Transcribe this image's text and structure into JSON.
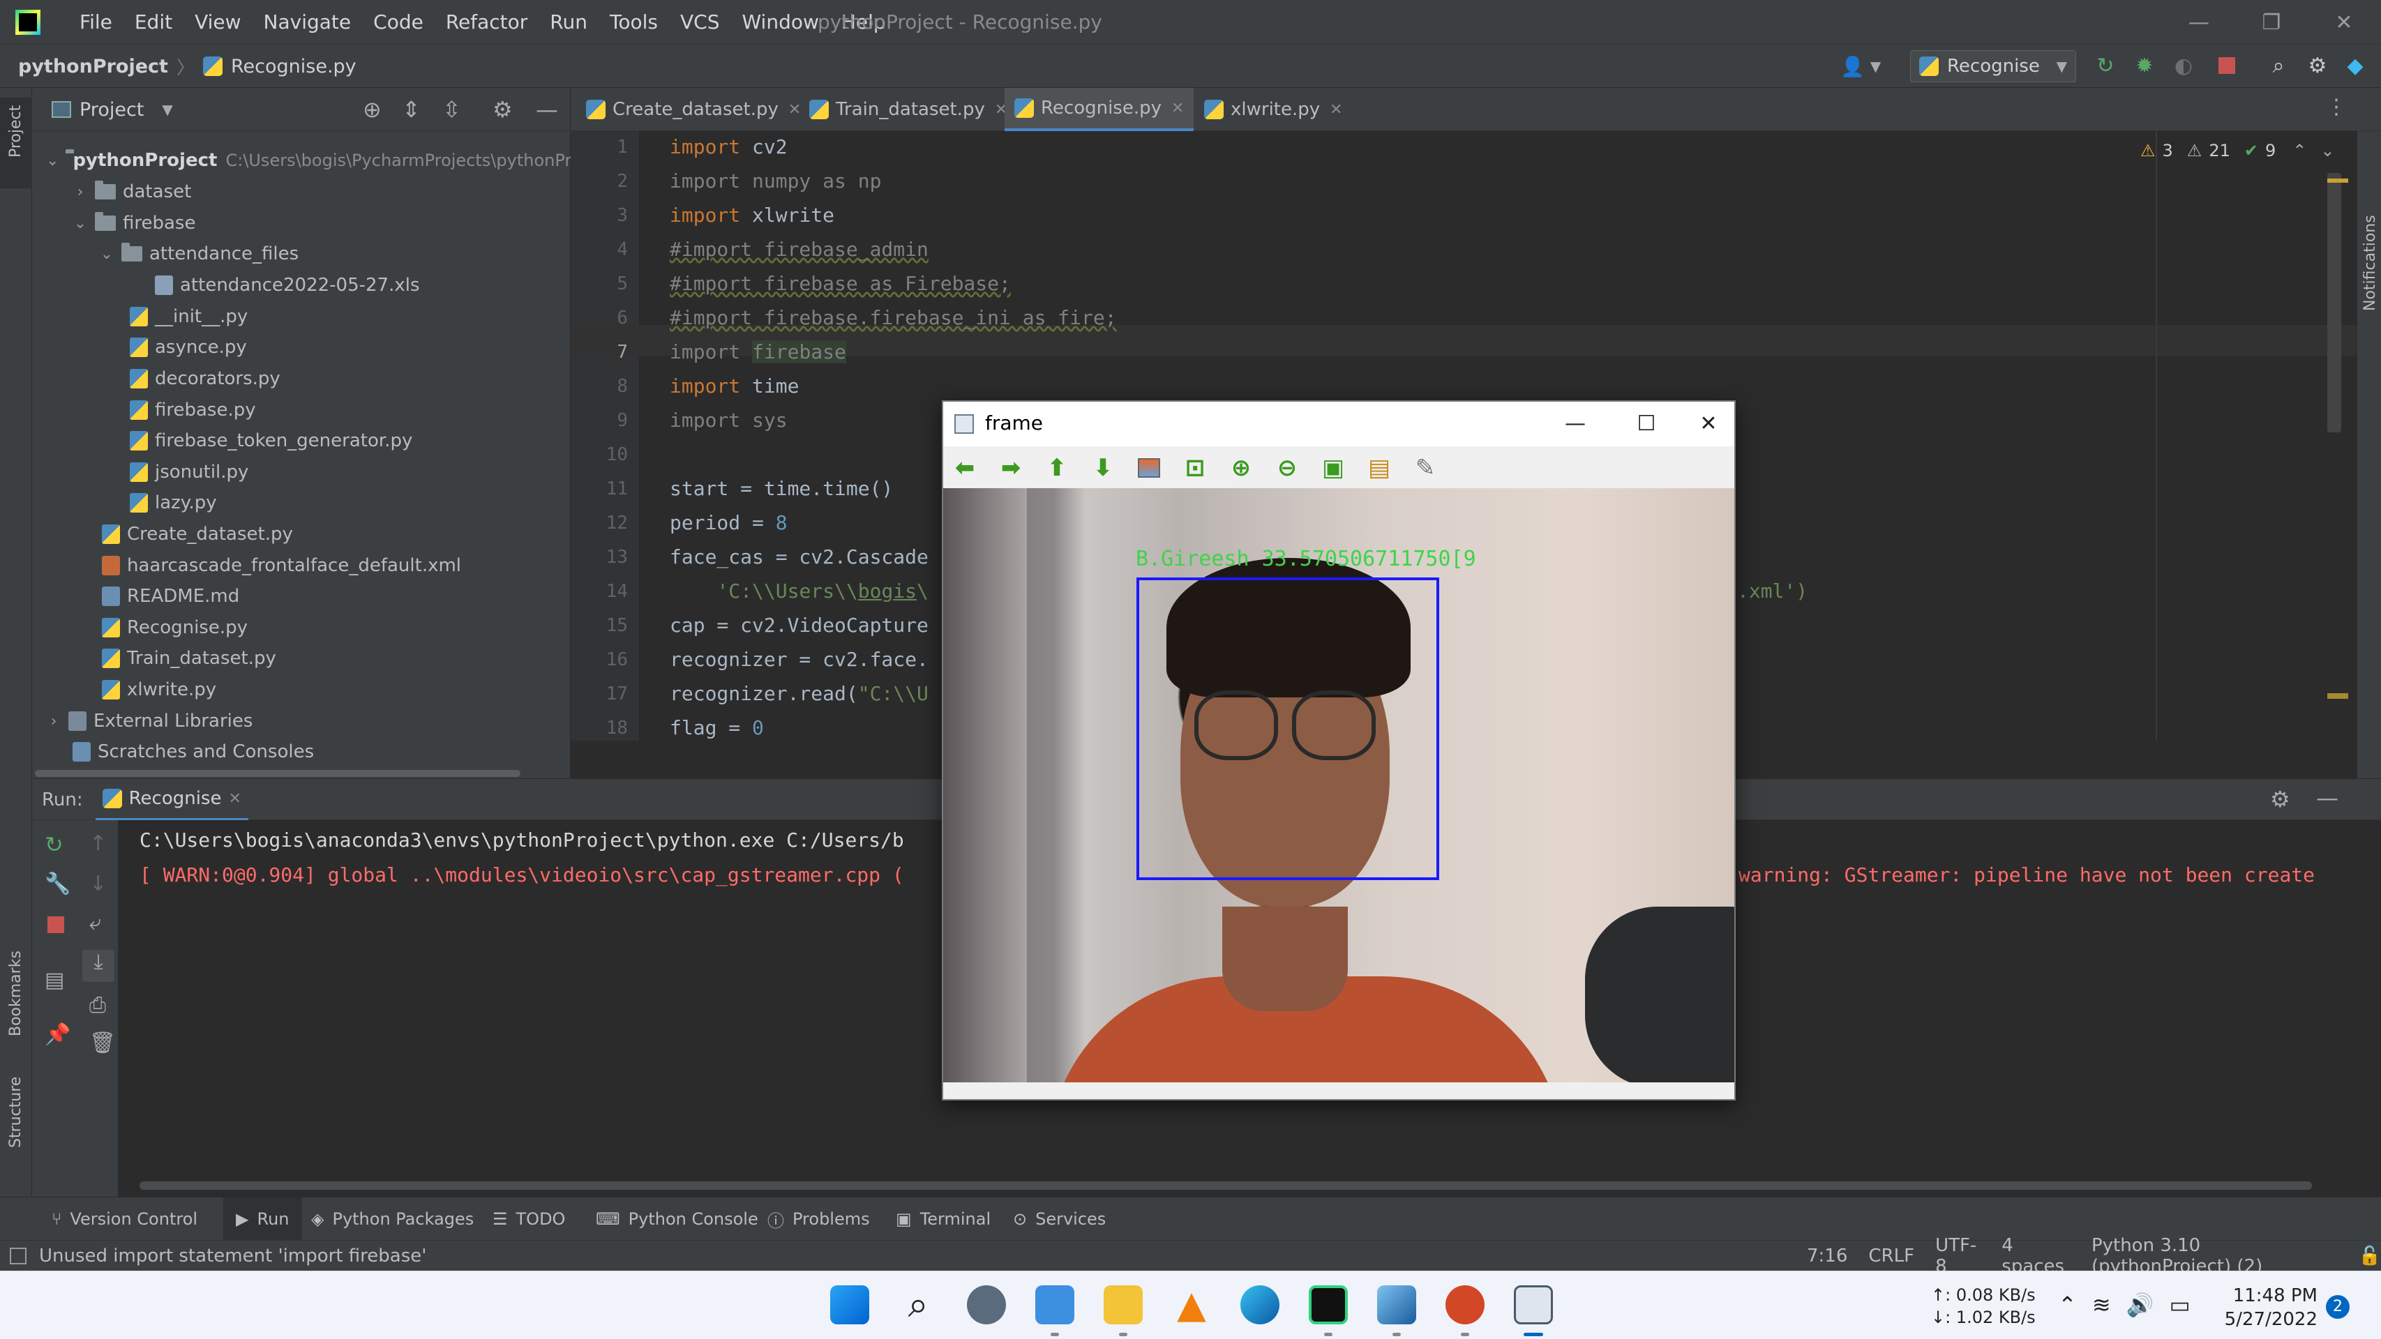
{
  "titlebar": {
    "menu": [
      "File",
      "Edit",
      "View",
      "Navigate",
      "Code",
      "Refactor",
      "Run",
      "Tools",
      "VCS",
      "Window",
      "Help"
    ],
    "window_title": "pythonProject - Recognise.py"
  },
  "navbar": {
    "project": "pythonProject",
    "file": "Recognise.py",
    "run_config": "Recognise"
  },
  "project_panel": {
    "title": "Project",
    "root_name": "pythonProject",
    "root_path": "C:\\Users\\bogis\\PycharmProjects\\pythonPr",
    "items": [
      {
        "label": "dataset"
      },
      {
        "label": "firebase"
      },
      {
        "label": "attendance_files"
      },
      {
        "label": "attendance2022-05-27.xls"
      },
      {
        "label": "__init__.py"
      },
      {
        "label": "asynce.py"
      },
      {
        "label": "decorators.py"
      },
      {
        "label": "firebase.py"
      },
      {
        "label": "firebase_token_generator.py"
      },
      {
        "label": "jsonutil.py"
      },
      {
        "label": "lazy.py"
      },
      {
        "label": "Create_dataset.py"
      },
      {
        "label": "haarcascade_frontalface_default.xml"
      },
      {
        "label": "README.md"
      },
      {
        "label": "Recognise.py"
      },
      {
        "label": "Train_dataset.py"
      },
      {
        "label": "xlwrite.py"
      },
      {
        "label": "External Libraries"
      },
      {
        "label": "Scratches and Consoles"
      }
    ]
  },
  "editor_tabs": [
    "Create_dataset.py",
    "Train_dataset.py",
    "Recognise.py",
    "xlwrite.py"
  ],
  "inspections": {
    "warnings": "3",
    "weak": "21",
    "ok": "9"
  },
  "code": {
    "line_numbers": [
      "1",
      "2",
      "3",
      "4",
      "5",
      "6",
      "7",
      "8",
      "9",
      "10",
      "11",
      "12",
      "13",
      "14",
      "15",
      "16",
      "17",
      "18"
    ],
    "l1_kw": "import",
    "l1": " cv2",
    "l2": "import numpy as np",
    "l3_kw": "import",
    "l3": " xlwrite",
    "l4": "#import firebase_admin",
    "l5": "#import firebase as Firebase;",
    "l6": "#import firebase.firebase_ini as fire;",
    "l7a": "import ",
    "l7b": "firebase",
    "l8_kw": "import",
    "l8": " time",
    "l9": "import sys",
    "l11": "start = time.time()",
    "l12a": "period = ",
    "l12b": "8",
    "l13": "face_cas = cv2.Cascade",
    "l14a": "    ",
    "l14b": "'C:\\\\Users\\\\",
    "l14c": "bogis",
    "l14d": "\\",
    "l14_tail": ".xml')",
    "l15": "cap = cv2.VideoCapture",
    "l16": "recognizer = cv2.face.",
    "l17a": "recognizer.read(",
    "l17b": "\"C:\\\\U",
    "l18a": "flag = ",
    "l18b": "0"
  },
  "run": {
    "label": "Run:",
    "tab": "Recognise",
    "line1": "C:\\Users\\bogis\\anaconda3\\envs\\pythonProject\\python.exe C:/Users/b",
    "line2": "[ WARN:0@0.904] global ..\\modules\\videoio\\src\\cap_gstreamer.cpp (",
    "line2_tail": "warning: GStreamer: pipeline have not been create"
  },
  "frame_window": {
    "title": "frame",
    "overlay_label": "B.Gireesh 33.570506711750[9"
  },
  "tool_tabs": [
    "Version Control",
    "Run",
    "Python Packages",
    "TODO",
    "Python Console",
    "Problems",
    "Terminal",
    "Services"
  ],
  "side_labels": {
    "project": "Project",
    "bookmarks": "Bookmarks",
    "structure": "Structure",
    "notifications": "Notifications"
  },
  "status": {
    "message": "Unused import statement 'import firebase'",
    "position": "7:16",
    "line_sep": "CRLF",
    "encoding": "UTF-8",
    "indent": "4 spaces",
    "interpreter": "Python 3.10 (pythonProject) (2)"
  },
  "taskbar": {
    "net_up": "↑: 0.08 KB/s",
    "net_down": "↓: 1.02 KB/s",
    "time": "11:48 PM",
    "date": "5/27/2022",
    "badge": "2"
  }
}
